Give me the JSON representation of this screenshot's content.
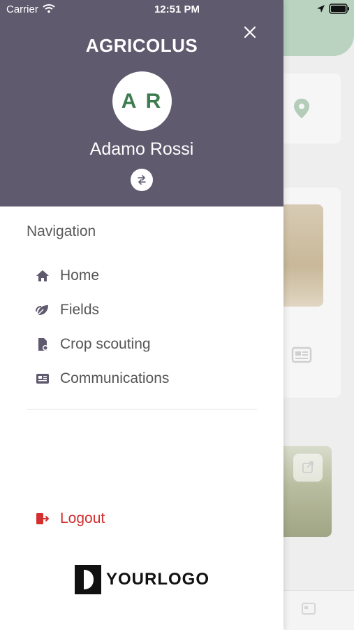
{
  "status_bar": {
    "carrier": "Carrier",
    "time": "12:51 PM"
  },
  "drawer": {
    "brand": "AGRICOLUS",
    "avatar_initials": "A R",
    "user_name": "Adamo Rossi",
    "nav_heading": "Navigation",
    "items": [
      {
        "label": "Home",
        "icon": "home-icon"
      },
      {
        "label": "Fields",
        "icon": "leaf-icon"
      },
      {
        "label": "Crop scouting",
        "icon": "document-pin-icon"
      },
      {
        "label": "Communications",
        "icon": "newspaper-icon"
      }
    ],
    "logout_label": "Logout",
    "logo_text": "YOURLOGO"
  },
  "colors": {
    "header_bg": "#5f5a6e",
    "avatar_text": "#3d7b50",
    "logout": "#d32f2f",
    "nav_icon": "#5f5a6e"
  }
}
